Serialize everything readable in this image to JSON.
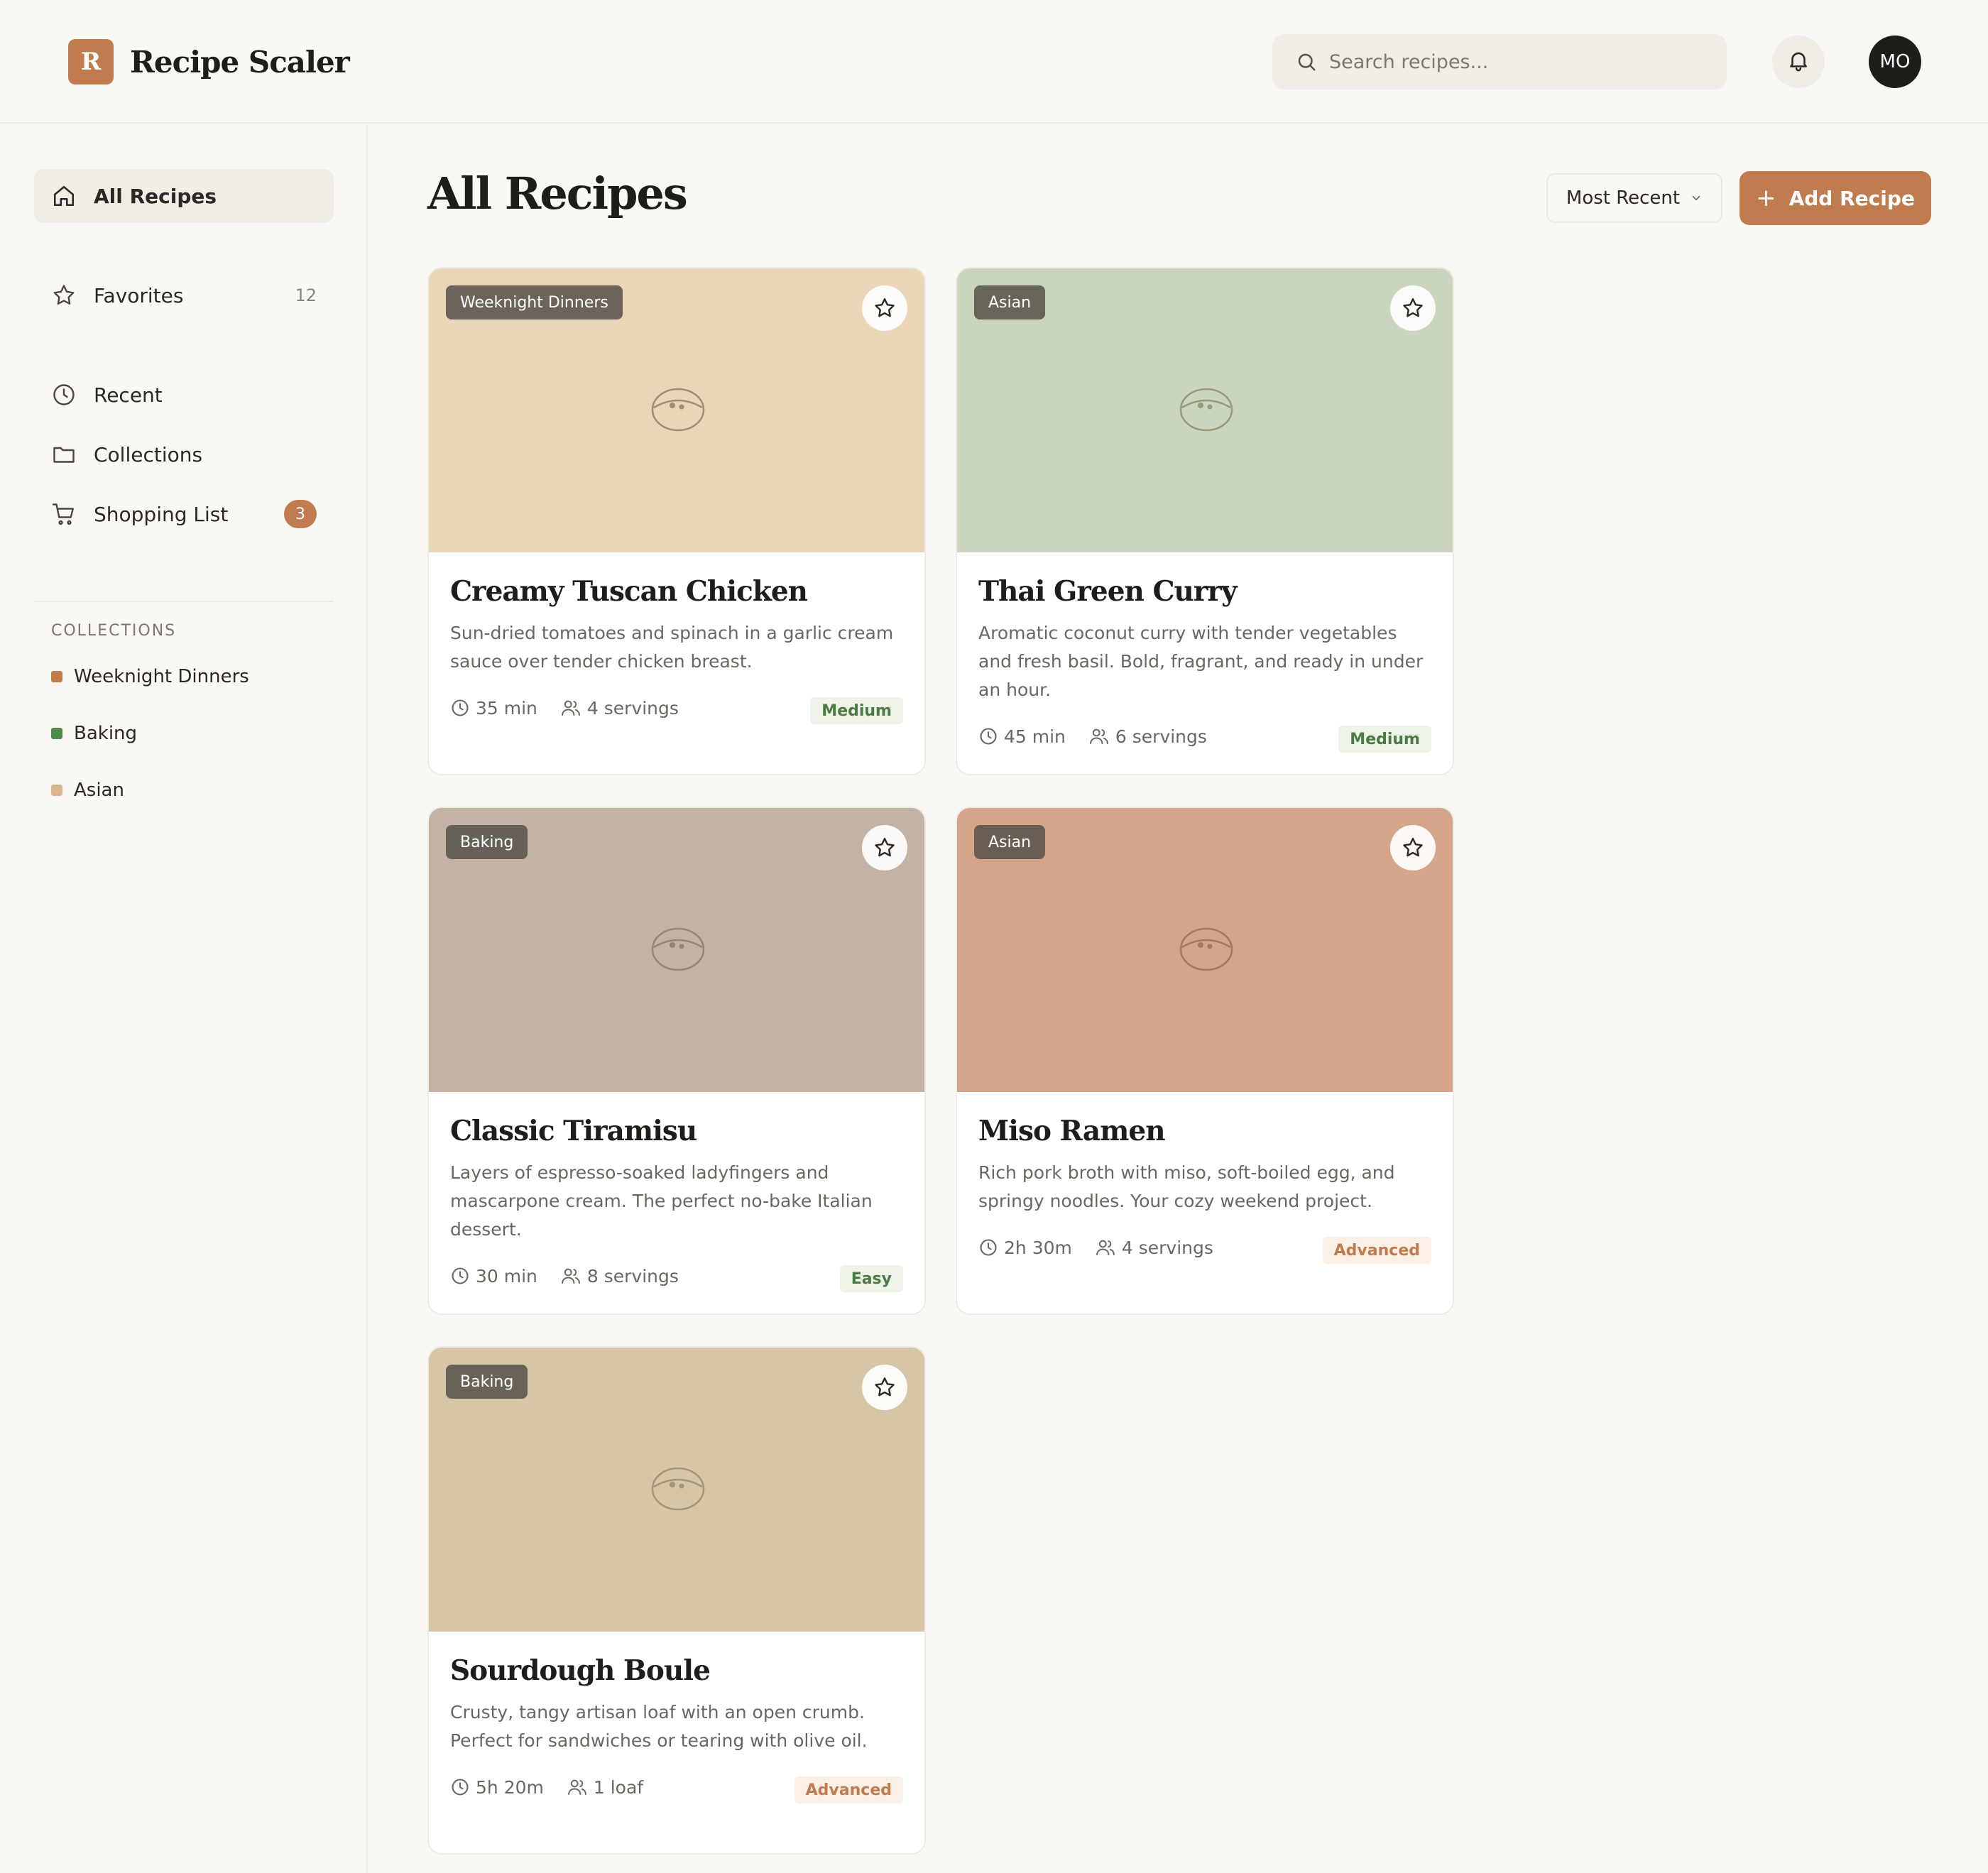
{
  "app": {
    "logo_letter": "R",
    "name": "Recipe Scaler"
  },
  "header": {
    "search_placeholder": "Search recipes...",
    "avatar_initials": "MO"
  },
  "sidebar": {
    "nav": [
      {
        "label": "All Recipes",
        "icon": "home-icon",
        "active": true
      },
      {
        "label": "Favorites",
        "icon": "star-icon",
        "count": "12"
      },
      {
        "label": "Recent",
        "icon": "clock-icon"
      },
      {
        "label": "Collections",
        "icon": "folder-icon"
      },
      {
        "label": "Shopping List",
        "icon": "cart-icon",
        "badge": "3"
      }
    ],
    "collections_title": "COLLECTIONS",
    "collections": [
      {
        "label": "Weeknight Dinners",
        "color": "#c07b4f"
      },
      {
        "label": "Baking",
        "color": "#4f8a47"
      },
      {
        "label": "Asian",
        "color": "#dbb48f"
      }
    ]
  },
  "main": {
    "title": "All Recipes",
    "sort_label": "Most Recent",
    "add_button": "Add Recipe",
    "recipes": [
      {
        "tag": "Weeknight Dinners",
        "title": "Creamy Tuscan Chicken",
        "description": "Sun-dried tomatoes and spinach in a garlic cream sauce over tender chicken breast.",
        "time": "35 min",
        "servings": "4 servings",
        "difficulty": "Medium",
        "color": "#e9d5b8"
      },
      {
        "tag": "Asian",
        "title": "Thai Green Curry",
        "description": "Aromatic coconut curry with tender vegetables and fresh basil. Bold, fragrant, and ready in under an hour.",
        "time": "45 min",
        "servings": "6 servings",
        "difficulty": "Medium",
        "color": "#c9d6bd"
      },
      {
        "tag": "Baking",
        "title": "Classic Tiramisu",
        "description": "Layers of espresso-soaked ladyfingers and mascarpone cream. The perfect no-bake Italian dessert.",
        "time": "30 min",
        "servings": "8 servings",
        "difficulty": "Easy",
        "color": "#c4b3a5"
      },
      {
        "tag": "Asian",
        "title": "Miso Ramen",
        "description": "Rich pork broth with miso, soft-boiled egg, and springy noodles. Your cozy weekend project.",
        "time": "2h 30m",
        "servings": "4 servings",
        "difficulty": "Advanced",
        "color": "#d4a589"
      },
      {
        "tag": "Baking",
        "title": "Sourdough Boule",
        "description": "Crusty, tangy artisan loaf with an open crumb. Perfect for sandwiches or tearing with olive oil.",
        "time": "5h 20m",
        "servings": "1 loaf",
        "difficulty": "Advanced",
        "color": "#d6c5a6"
      }
    ]
  }
}
